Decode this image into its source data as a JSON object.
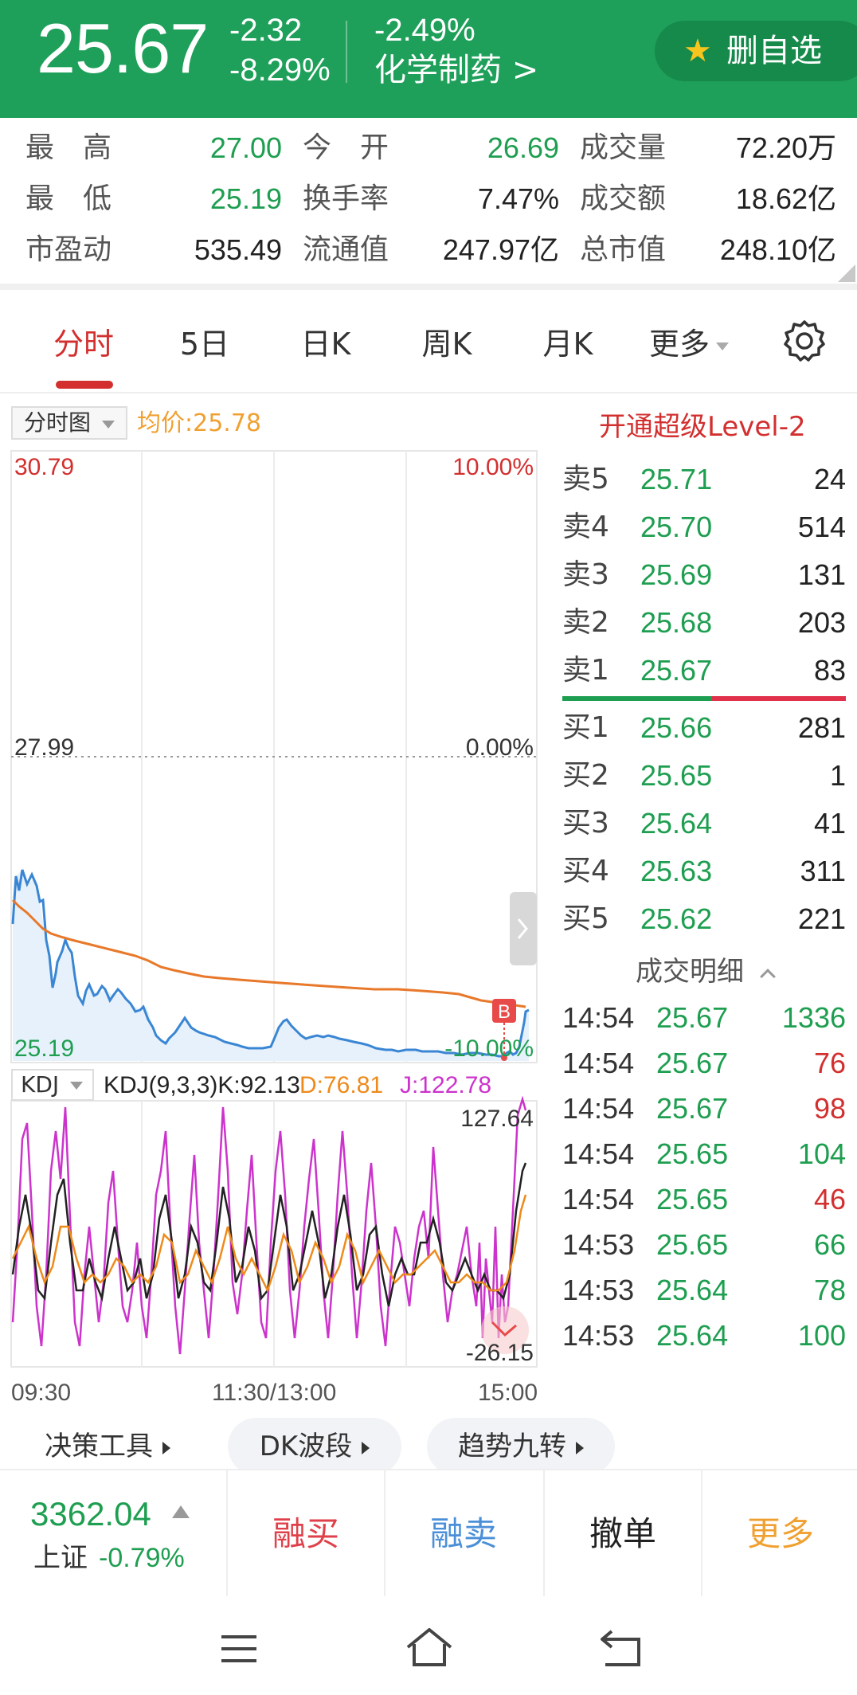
{
  "header": {
    "price": "25.67",
    "change": "-2.32",
    "change_pct": "-8.29%",
    "sector_change": "-2.49%",
    "sector_name": "化学制药 >",
    "fav_label": "删自选",
    "colors": {
      "bg": "#1fa05a",
      "fav_bg": "#168a4b",
      "star": "#f7c51e"
    }
  },
  "stats": [
    [
      {
        "label": "最　高",
        "value": "27.00",
        "tone": "green"
      },
      {
        "label": "今　开",
        "value": "26.69",
        "tone": "green"
      },
      {
        "label": "成交量",
        "value": "72.20万",
        "tone": "dark"
      }
    ],
    [
      {
        "label": "最　低",
        "value": "25.19",
        "tone": "green"
      },
      {
        "label": "换手率",
        "value": "7.47%",
        "tone": "dark"
      },
      {
        "label": "成交额",
        "value": "18.62亿",
        "tone": "dark"
      }
    ],
    [
      {
        "label": "市盈动",
        "value": "535.49",
        "tone": "dark"
      },
      {
        "label": "流通值",
        "value": "247.97亿",
        "tone": "dark"
      },
      {
        "label": "总市值",
        "value": "248.10亿",
        "tone": "dark"
      }
    ]
  ],
  "tabs": [
    "分时",
    "5日",
    "日K",
    "周K",
    "月K",
    "更多"
  ],
  "active_tab": "分时",
  "chart": {
    "type_selector": "分时图",
    "avg_price": "均价:25.78",
    "upgrade_link": "开通超级Level-2",
    "price_top": "30.79",
    "pct_top": "10.00%",
    "price_mid": "27.99",
    "pct_mid": "0.00%",
    "price_bottom": "25.19",
    "pct_bottom": "-10.00%",
    "marker": "B",
    "kdj_selector": "KDJ",
    "kdj_label": "KDJ(9,3,3)K:92.13",
    "kdj_d": "D:76.81",
    "kdj_j": "J:122.78",
    "kdj_max": "127.64",
    "kdj_min": "-26.15",
    "time_start": "09:30",
    "time_mid": "11:30/13:00",
    "time_end": "15:00"
  },
  "order_book": {
    "asks": [
      {
        "label": "卖5",
        "price": "25.71",
        "volume": "24"
      },
      {
        "label": "卖4",
        "price": "25.70",
        "volume": "514"
      },
      {
        "label": "卖3",
        "price": "25.69",
        "volume": "131"
      },
      {
        "label": "卖2",
        "price": "25.68",
        "volume": "203"
      },
      {
        "label": "卖1",
        "price": "25.67",
        "volume": "83"
      }
    ],
    "bids": [
      {
        "label": "买1",
        "price": "25.66",
        "volume": "281"
      },
      {
        "label": "买2",
        "price": "25.65",
        "volume": "1"
      },
      {
        "label": "买3",
        "price": "25.64",
        "volume": "41"
      },
      {
        "label": "买4",
        "price": "25.63",
        "volume": "311"
      },
      {
        "label": "买5",
        "price": "25.62",
        "volume": "221"
      }
    ]
  },
  "trades_header": "成交明细",
  "trades": [
    {
      "time": "14:54",
      "price": "25.67",
      "volume": "1336",
      "side": "sell"
    },
    {
      "time": "14:54",
      "price": "25.67",
      "volume": "76",
      "side": "buy"
    },
    {
      "time": "14:54",
      "price": "25.67",
      "volume": "98",
      "side": "buy"
    },
    {
      "time": "14:54",
      "price": "25.65",
      "volume": "104",
      "side": "sell"
    },
    {
      "time": "14:54",
      "price": "25.65",
      "volume": "46",
      "side": "buy"
    },
    {
      "time": "14:53",
      "price": "25.65",
      "volume": "66",
      "side": "sell"
    },
    {
      "time": "14:53",
      "price": "25.64",
      "volume": "78",
      "side": "sell"
    },
    {
      "time": "14:53",
      "price": "25.64",
      "volume": "100",
      "side": "sell"
    }
  ],
  "tools": [
    "决策工具",
    "DK波段",
    "趋势九转"
  ],
  "index": {
    "value": "3362.04",
    "name": "上证",
    "change": "-0.79%"
  },
  "actions": [
    {
      "label": "融买",
      "color": "#e0404a"
    },
    {
      "label": "融卖",
      "color": "#4a8fd8"
    },
    {
      "label": "撤单",
      "color": "#222222"
    },
    {
      "label": "更多",
      "color": "#f0a030"
    }
  ],
  "system_nav": [
    "menu-icon",
    "home-icon",
    "back-icon"
  ]
}
